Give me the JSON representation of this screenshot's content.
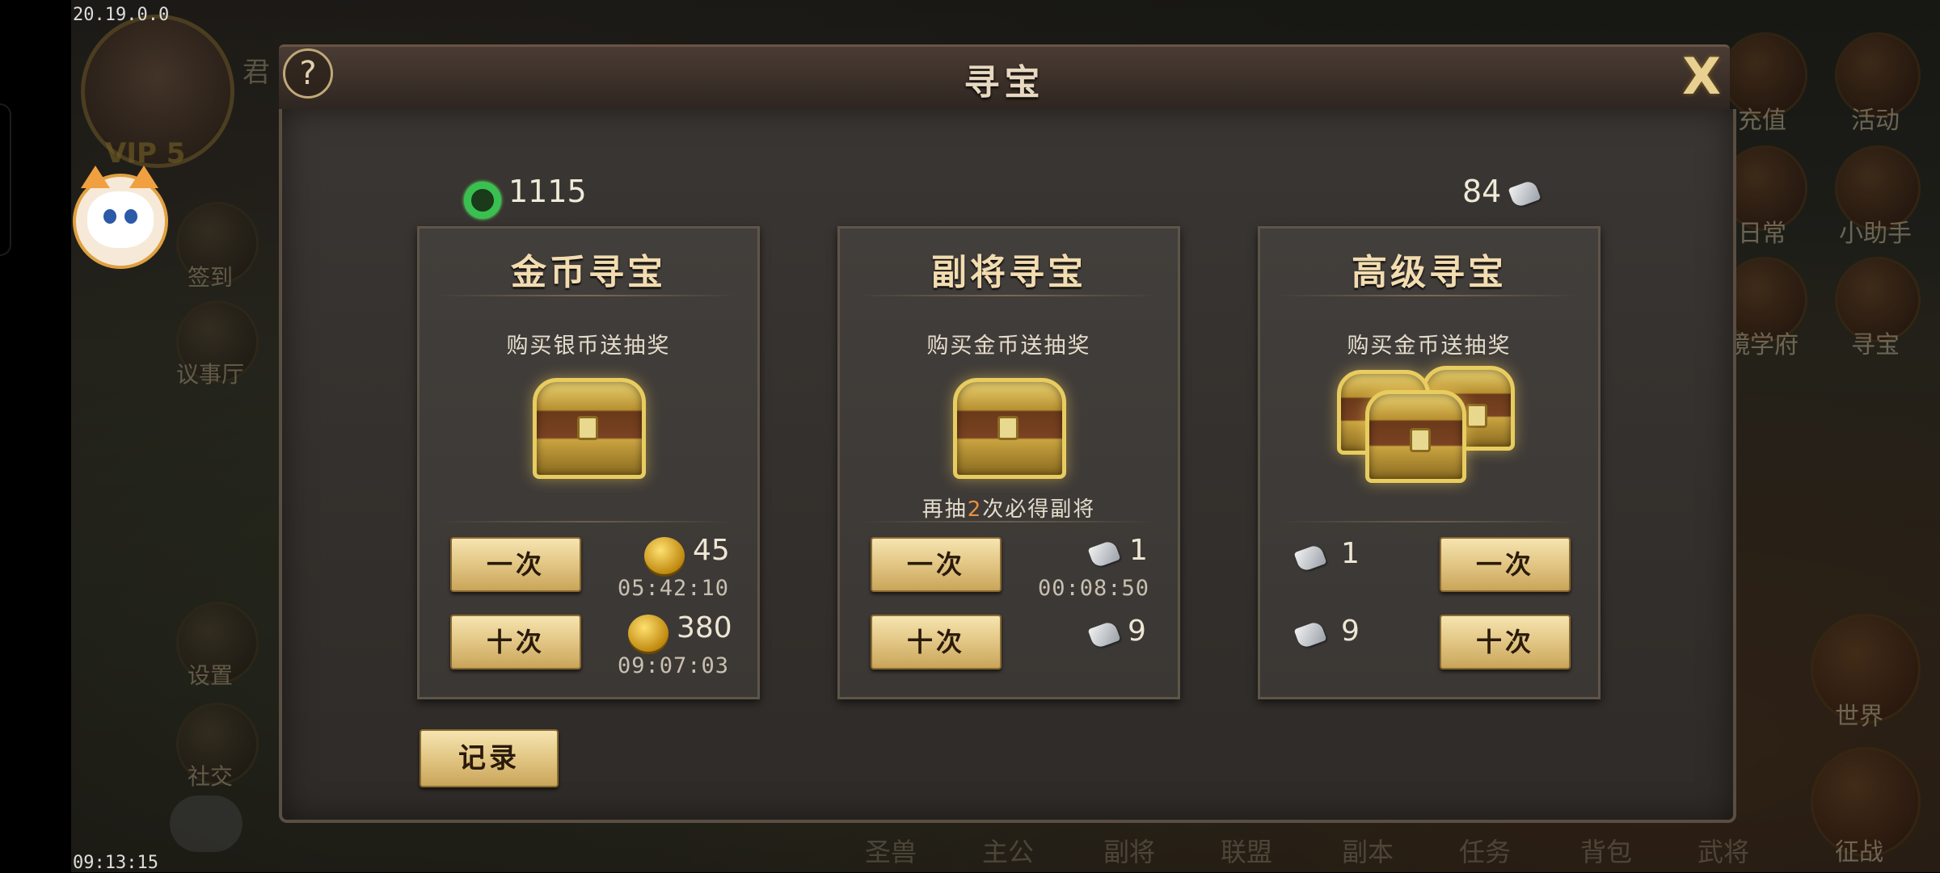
{
  "status_bar": {
    "ip": "20.19.0.0",
    "clock": "09:13:15"
  },
  "background_ui": {
    "vip_label": "VIP 5",
    "player_name_char": "君",
    "left_icons": [
      {
        "label": "签到",
        "icon": "checkin-icon"
      },
      {
        "label": "议事厅",
        "icon": "council-hall-icon"
      },
      {
        "label": "设置",
        "icon": "settings-gear-icon"
      },
      {
        "label": "社交",
        "icon": "social-helmet-icon"
      }
    ],
    "right_icons": [
      {
        "label": "充值",
        "icon": "recharge-gold-icon"
      },
      {
        "label": "活动",
        "icon": "gift-box-icon"
      },
      {
        "label": "日常",
        "icon": "daily-icon"
      },
      {
        "label": "小助手",
        "icon": "helper-scroll-icon"
      },
      {
        "label": "镜学府",
        "icon": "academy-icon"
      },
      {
        "label": "寻宝",
        "icon": "treasure-chest-icon"
      },
      {
        "label": "世界",
        "icon": "world-dragon-icon"
      },
      {
        "label": "征战",
        "icon": "campaign-dragon-icon"
      }
    ],
    "bottom_nav": [
      "圣兽",
      "主公",
      "副将",
      "联盟",
      "副本",
      "任务",
      "背包",
      "武将"
    ]
  },
  "dialog": {
    "title": "寻宝",
    "help_label": "?",
    "close_label": "X",
    "jade_balance": "1115",
    "scroll_balance": "84",
    "record_label": "记录",
    "cards": [
      {
        "title": "金币寻宝",
        "subtitle": "购买银币送抽奖",
        "once_label": "一次",
        "ten_label": "十次",
        "once_cost": "45",
        "once_timer": "05:42:10",
        "ten_cost": "380",
        "ten_timer": "09:07:03"
      },
      {
        "title": "副将寻宝",
        "subtitle": "购买金币送抽奖",
        "note_pre": "再抽",
        "note_num": "2",
        "note_post": "次必得副将",
        "once_label": "一次",
        "ten_label": "十次",
        "once_cost": "1",
        "once_timer": "00:08:50",
        "ten_cost": "9"
      },
      {
        "title": "高级寻宝",
        "subtitle": "购买金币送抽奖",
        "once_label": "一次",
        "ten_label": "十次",
        "once_cost": "1",
        "ten_cost": "9"
      }
    ]
  }
}
